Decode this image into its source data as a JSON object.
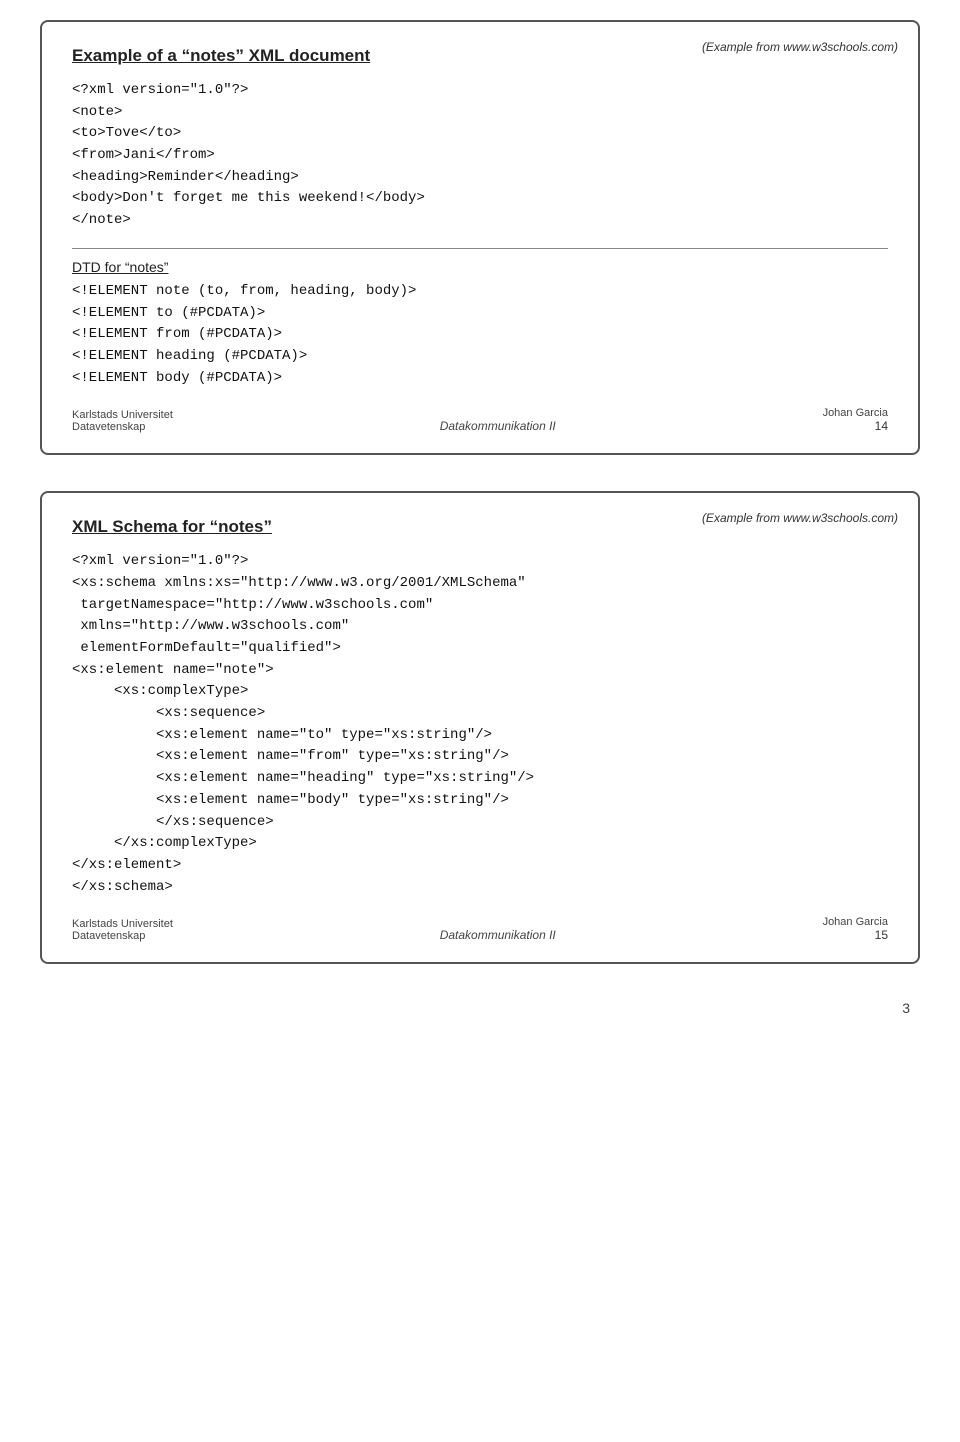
{
  "page": {
    "page_number": "3"
  },
  "slide1": {
    "title": "Example of a “notes” XML document",
    "example_label": "(Example from www.w3schools.com)",
    "xml_code": "<?xml version=\"1.0\"?>\n<note>\n<to>Tove</to>\n<from>Jani</from>\n<heading>Reminder</heading>\n<body>Don't forget me this weekend!</body>\n</note>",
    "dtd_label": "DTD for “notes”",
    "dtd_code": "<!ELEMENT note (to, from, heading, body)>\n<!ELEMENT to (#PCDATA)>\n<!ELEMENT from (#PCDATA)>\n<!ELEMENT heading (#PCDATA)>\n<!ELEMENT body (#PCDATA)>",
    "footer": {
      "left_line1": "Karlstads Universitet",
      "left_line2": "Datavetenskap",
      "center": "Datakommunikation II",
      "right": "Johan Garcia",
      "page_num": "14"
    }
  },
  "slide2": {
    "title": "XML Schema for “notes”",
    "example_label": "(Example from www.w3schools.com)",
    "xml_code": "<?xml version=\"1.0\"?>\n<xs:schema xmlns:xs=\"http://www.w3.org/2001/XMLSchema\"\n targetNamespace=\"http://www.w3schools.com\"\n xmlns=\"http://www.w3schools.com\"\n elementFormDefault=\"qualified\">\n<xs:element name=\"note\">\n     <xs:complexType>\n          <xs:sequence>\n          <xs:element name=\"to\" type=\"xs:string\"/>\n          <xs:element name=\"from\" type=\"xs:string\"/>\n          <xs:element name=\"heading\" type=\"xs:string\"/>\n          <xs:element name=\"body\" type=\"xs:string\"/>\n          </xs:sequence>\n     </xs:complexType>\n</xs:element>\n</xs:schema>",
    "footer": {
      "left_line1": "Karlstads Universitet",
      "left_line2": "Datavetenskap",
      "center": "Datakommunikation II",
      "right": "Johan Garcia",
      "page_num": "15"
    }
  }
}
